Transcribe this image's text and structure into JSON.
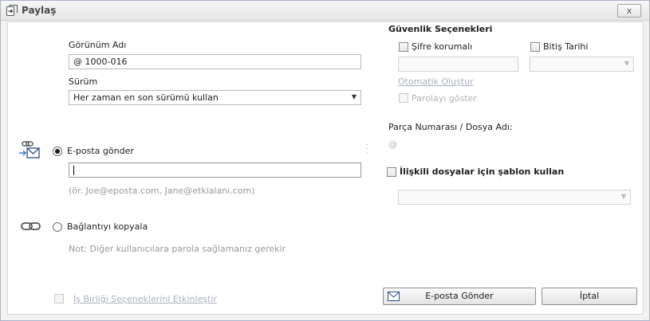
{
  "window": {
    "title": "Paylaş",
    "close_glyph": "x"
  },
  "left": {
    "view_name_label": "Görünüm Adı",
    "view_name_value": "@ 1000-016",
    "version_label": "Sürüm",
    "version_value": "Her zaman en son sürümü kullan",
    "email_option_label": "E-posta gönder",
    "email_value": "",
    "email_hint": "(ör.  Joe@eposta.com, Jane@etkialanı.com)",
    "copy_link_label": "Bağlantıyı kopyala",
    "copy_link_note": "Not: Diğer kullanıcılara parola sağlamanız gerekir",
    "collab_label": "İş Birliği Seçeneklerini Etkinleştir",
    "email_option_selected": true
  },
  "right": {
    "security_heading": "Güvenlik Seçenekleri",
    "password_protect_label": "Şifre korumalı",
    "expiry_label": "Bitiş Tarihi",
    "password_value": "",
    "expiry_value": "",
    "auto_generate_link": "Otomatik Oluştur",
    "show_password_label": "Parolayı göster",
    "part_number_label": "Parça Numarası / Dosya Adı:",
    "part_number_value": "@",
    "template_label": "İlişkili dosyalar için şablon kullan",
    "template_value": ""
  },
  "buttons": {
    "send_email": "E-posta Gönder",
    "cancel": "İptal"
  },
  "icons": [
    "share-icon",
    "email-link-icon",
    "link-icon",
    "envelope-icon"
  ]
}
